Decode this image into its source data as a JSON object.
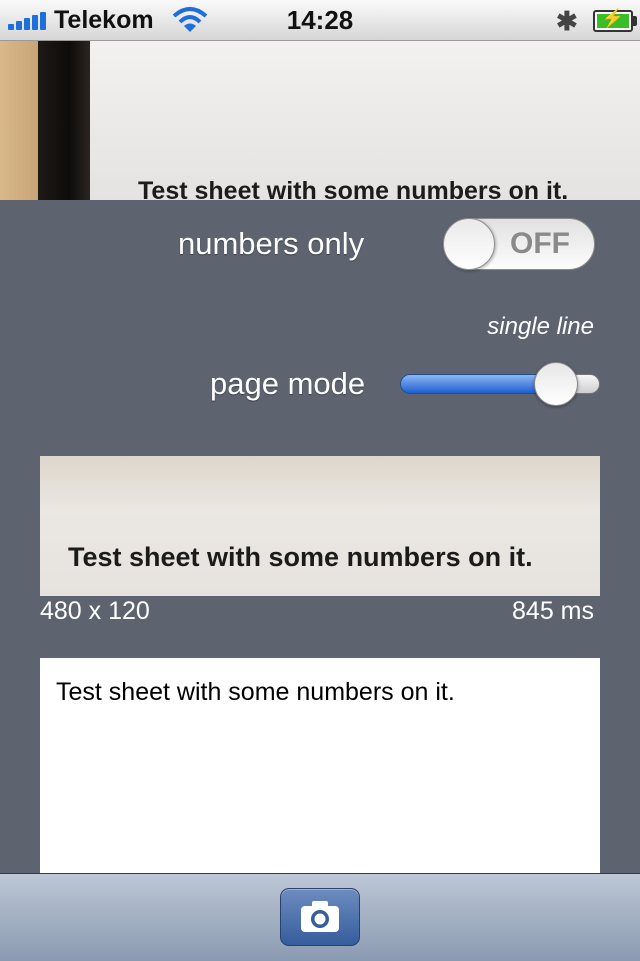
{
  "status_bar": {
    "carrier": "Telekom",
    "time": "14:28",
    "icons": [
      "signal-icon",
      "wifi-icon",
      "bluetooth-icon",
      "battery-charging-icon"
    ],
    "signal_color": "#1e6fd8"
  },
  "camera_preview": {
    "text": "Test sheet with some numbers on it."
  },
  "controls": {
    "numbers_only_label": "numbers only",
    "numbers_only_state": "OFF",
    "page_mode_label": "page mode",
    "page_mode_value_label": "single line",
    "page_mode_slider_level": 0.78,
    "slider_color": "#1d5fd2"
  },
  "crop": {
    "text": "Test sheet with some numbers on it.",
    "dimensions": "480 x 120",
    "duration": "845 ms"
  },
  "result": {
    "text": "Test sheet with some numbers on it."
  },
  "toolbar": {
    "camera_icon": "camera-icon"
  },
  "colors": {
    "background": "#5d6470",
    "toolbar": "#8a9ab0",
    "camera_button": "#365d9c"
  }
}
